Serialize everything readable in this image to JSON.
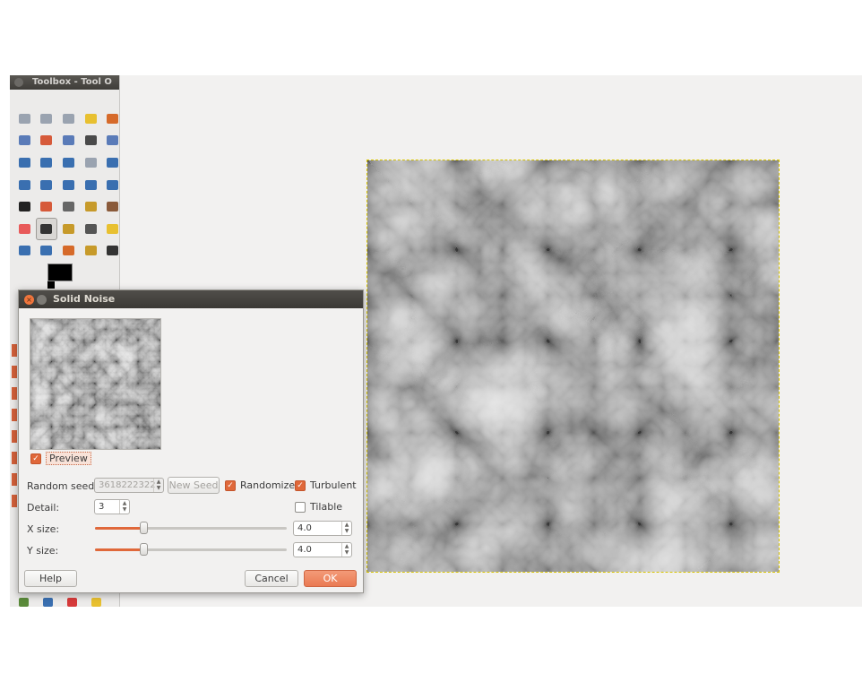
{
  "toolbox": {
    "title": "Toolbox - Tool O",
    "tool_colors": [
      "#9aa3b0",
      "#9aa3b0",
      "#9aa3b0",
      "#e8c030",
      "#d66a2a",
      "#5a7bb8",
      "#d65a3a",
      "#5a7bb8",
      "#4a4a4a",
      "#5a7bb8",
      "#3a6fb0",
      "#3a6fb0",
      "#3a6fb0",
      "#9aa3b0",
      "#3a6fb0",
      "#3a6fb0",
      "#3a6fb0",
      "#3a6fb0",
      "#3a6fb0",
      "#3a6fb0",
      "#222222",
      "#d65a3a",
      "#666666",
      "#c79a2a",
      "#8a5a3a",
      "#e85a5a",
      "#333333",
      "#c79a2a",
      "#555555",
      "#e8c030",
      "#3a6fb0",
      "#3a6fb0",
      "#d66a2a",
      "#c79a2a",
      "#333333"
    ],
    "active_tool_index": 26,
    "fg_color": "#000000"
  },
  "dialog": {
    "title": "Solid Noise",
    "preview_label": "Preview",
    "preview_checked": true,
    "random_seed_label": "Random seed:",
    "random_seed_value": "3618222322",
    "new_seed_label": "New Seed",
    "randomize_label": "Randomize",
    "randomize_checked": true,
    "turbulent_label": "Turbulent",
    "turbulent_checked": true,
    "detail_label": "Detail:",
    "detail_value": "3",
    "tilable_label": "Tilable",
    "tilable_checked": false,
    "x_size_label": "X size:",
    "x_size_value": "4.0",
    "x_size_fraction": 0.25,
    "y_size_label": "Y size:",
    "y_size_value": "4.0",
    "y_size_fraction": 0.25,
    "help_label": "Help",
    "cancel_label": "Cancel",
    "ok_label": "OK"
  }
}
